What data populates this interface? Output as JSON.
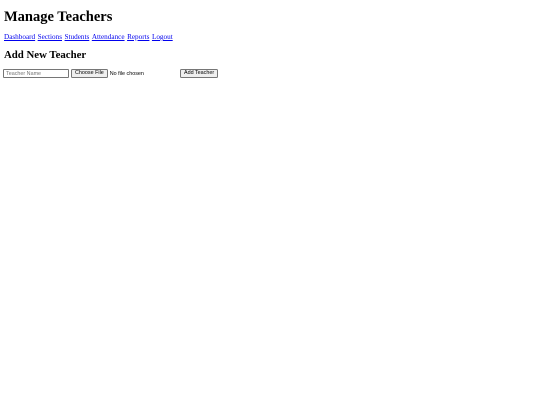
{
  "page": {
    "title": "Manage Teachers"
  },
  "nav": {
    "links": [
      {
        "label": "Dashboard"
      },
      {
        "label": "Sections"
      },
      {
        "label": "Students"
      },
      {
        "label": "Attendance"
      },
      {
        "label": "Reports"
      },
      {
        "label": "Logout"
      }
    ]
  },
  "add_section": {
    "title": "Add New Teacher",
    "name_input": {
      "value": "",
      "placeholder": "Teacher Name"
    },
    "file_input": {
      "button_label": "Choose File",
      "status": "No file chosen"
    },
    "submit_label": "Add Teacher"
  },
  "colors": {
    "link": "#0000ee",
    "background": "#ffffff",
    "button_bg": "#efefef",
    "control_border": "#767676"
  }
}
